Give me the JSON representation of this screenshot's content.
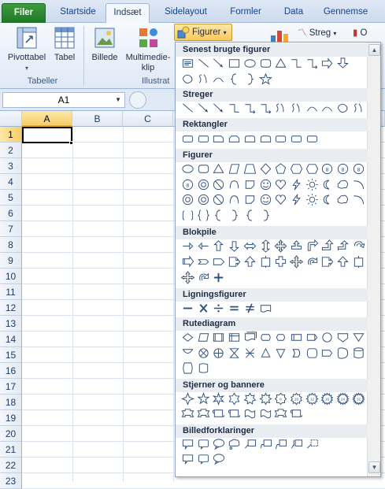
{
  "tabs": [
    {
      "label": "Filer",
      "name": "tab-file"
    },
    {
      "label": "Startside",
      "name": "tab-startside"
    },
    {
      "label": "Indsæt",
      "name": "tab-indsaet"
    },
    {
      "label": "Sidelayout",
      "name": "tab-sidelayout"
    },
    {
      "label": "Formler",
      "name": "tab-formler"
    },
    {
      "label": "Data",
      "name": "tab-data"
    },
    {
      "label": "Gennemse",
      "name": "tab-gennemse"
    }
  ],
  "ribbon": {
    "pivot_label": "Pivottabel",
    "table_label": "Tabel",
    "picture_label": "Billede",
    "clipart_label_1": "Multimedie-",
    "clipart_label_2": "klip",
    "shapes_label": "Figurer",
    "lines_label": "Streg",
    "extra_label": "O",
    "group_tables": "Tabeller",
    "group_illustrations": "Illustrat"
  },
  "formula_bar": {
    "name_box": "A1"
  },
  "grid": {
    "columns": [
      "A",
      "B",
      "C"
    ],
    "rows": [
      "1",
      "2",
      "3",
      "4",
      "5",
      "6",
      "7",
      "8",
      "9",
      "10",
      "11",
      "12",
      "13",
      "14",
      "15",
      "16",
      "17",
      "18",
      "19",
      "20",
      "21",
      "22",
      "23"
    ],
    "active_cell": "A1"
  },
  "shapes_menu": {
    "sections": [
      "Senest brugte figurer",
      "Streger",
      "Rektangler",
      "Figurer",
      "Blokpile",
      "Ligningsfigurer",
      "Rutediagram",
      "Stjerner og bannere",
      "Billedforklaringer"
    ]
  },
  "colors": {
    "file_tab": "#2a8a2f",
    "ribbon_text": "#15428b",
    "highlight": "#f8c95e",
    "shape_stroke": "#2f4f7a"
  }
}
